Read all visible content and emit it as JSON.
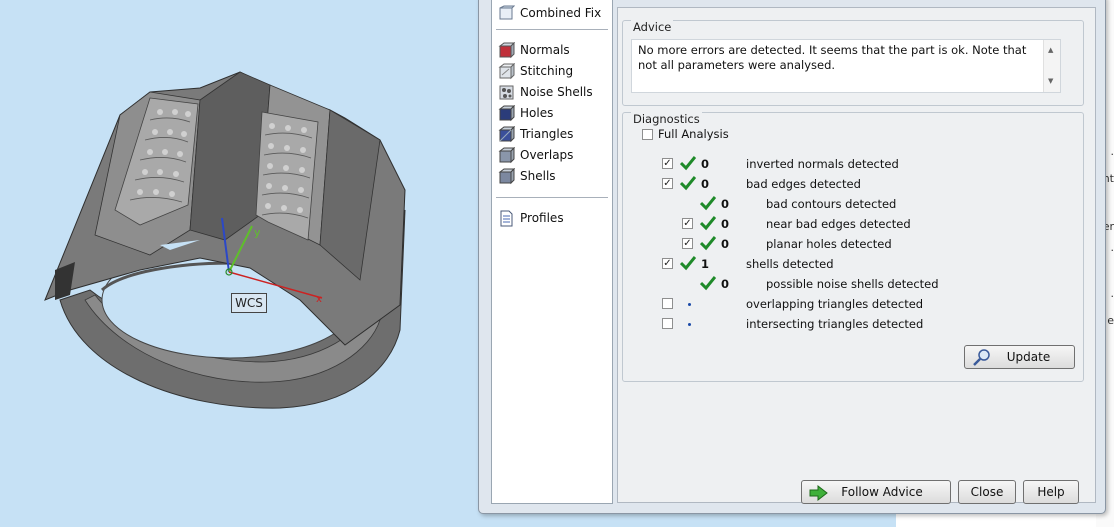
{
  "viewport": {
    "wcs_label": "WCS"
  },
  "nav": {
    "top_item": "Combined Fix",
    "items": [
      {
        "label": "Normals",
        "icon": "normals-icon"
      },
      {
        "label": "Stitching",
        "icon": "stitching-icon"
      },
      {
        "label": "Noise Shells",
        "icon": "noise-shells-icon"
      },
      {
        "label": "Holes",
        "icon": "holes-icon"
      },
      {
        "label": "Triangles",
        "icon": "triangles-icon"
      },
      {
        "label": "Overlaps",
        "icon": "overlaps-icon"
      },
      {
        "label": "Shells",
        "icon": "shells-icon"
      }
    ],
    "profiles": "Profiles"
  },
  "advice": {
    "title": "Advice",
    "text": "No more errors are detected. It seems that the part is ok. Note that not all parameters were analysed."
  },
  "diagnostics": {
    "title": "Diagnostics",
    "full_analysis_label": "Full Analysis",
    "full_analysis_checked": false,
    "rows": [
      {
        "checked": true,
        "status": "ok",
        "count": "0",
        "label": "inverted normals detected"
      },
      {
        "checked": true,
        "status": "ok",
        "count": "0",
        "label": "bad edges detected"
      },
      {
        "checked": null,
        "status": "ok",
        "count": "0",
        "label": "bad contours detected"
      },
      {
        "checked": true,
        "status": "ok",
        "count": "0",
        "label": "near bad edges detected"
      },
      {
        "checked": true,
        "status": "ok",
        "count": "0",
        "label": "planar holes detected"
      },
      {
        "checked": true,
        "status": "ok",
        "count": "1",
        "label": "shells detected"
      },
      {
        "checked": null,
        "status": "ok",
        "count": "0",
        "label": "possible noise shells detected"
      },
      {
        "checked": false,
        "status": "not-run",
        "count": "",
        "label": "overlapping triangles detected"
      },
      {
        "checked": false,
        "status": "not-run",
        "count": "",
        "label": "intersecting triangles detected"
      }
    ],
    "update_label": "Update"
  },
  "footer": {
    "follow_advice_label": "Follow Advice",
    "close_label": "Close",
    "help_label": "Help"
  },
  "colors": {
    "check_green": "#1f8a2a",
    "viewport_bg": "#c6e1f5",
    "dialog_bg": "#dfe6ee"
  }
}
